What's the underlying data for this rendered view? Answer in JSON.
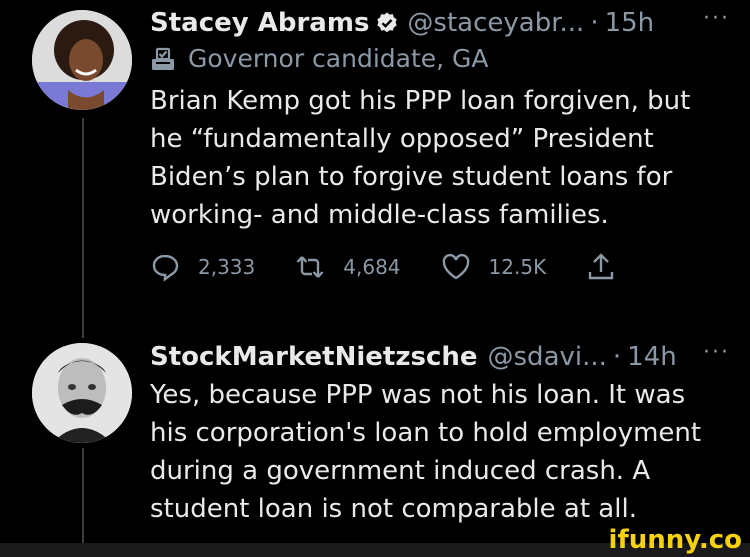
{
  "tweets": [
    {
      "name": "Stacey Abrams",
      "handle": "@staceyabr...",
      "separator": "·",
      "time": "15h",
      "more": "···",
      "label": "Governor candidate, GA",
      "text": "Brian Kemp got his PPP loan forgiven, but he “fundamentally opposed” President Biden’s plan to forgive student loans for working- and middle-class families.",
      "actions": {
        "replies": "2,333",
        "retweets": "4,684",
        "likes": "12.5K"
      }
    },
    {
      "name": "StockMarketNietzsche",
      "handle": "@sdavi...",
      "separator": "·",
      "time": "14h",
      "more": "···",
      "text": "Yes, because PPP was not his loan. It was his corporation's loan to hold employment during a government induced crash. A student loan is not comparable at all."
    }
  ],
  "watermark": "ifunny.co",
  "colors": {
    "background": "#000000",
    "text": "#e7e9ea",
    "secondary": "#8b98a5",
    "verified": "#e7e9ea",
    "watermark": "#f5d20a"
  }
}
